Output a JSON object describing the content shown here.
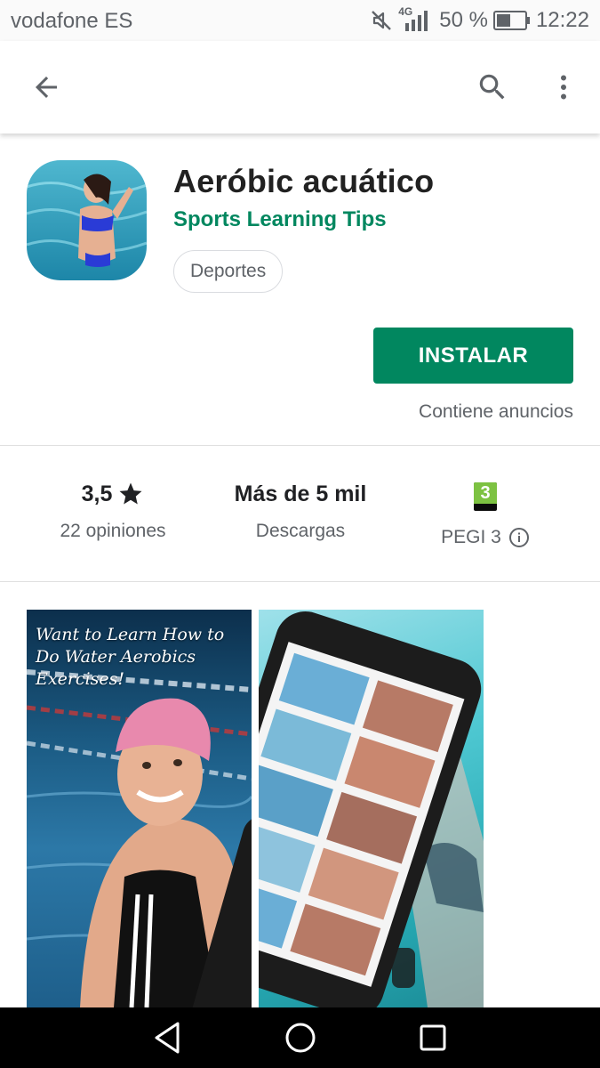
{
  "status_bar": {
    "carrier": "vodafone ES",
    "network": "4G",
    "battery": "50 %",
    "battery_level": 0.5,
    "time": "12:22"
  },
  "toolbar": {
    "back_icon": "arrow-back-icon",
    "search_icon": "search-icon",
    "more_icon": "more-vert-icon"
  },
  "app": {
    "title": "Aeróbic acuático",
    "developer": "Sports Learning Tips",
    "category": "Deportes",
    "install_label": "INSTALAR",
    "ads_note": "Contiene anuncios"
  },
  "stats": {
    "rating": "3,5",
    "rating_label": "22 opiniones",
    "downloads": "Más de 5 mil",
    "downloads_label": "Descargas",
    "pegi_number": "3",
    "pegi_label": "PEGI 3"
  },
  "screenshots": {
    "first_caption": "Want to Learn How to Do Water Aerobics Exercises!"
  },
  "colors": {
    "accent": "#01875f",
    "text_primary": "#212121",
    "text_secondary": "#5f6368",
    "pegi_green": "#7dc242"
  },
  "nav": {
    "back_icon": "nav-back-icon",
    "home_icon": "nav-home-icon",
    "recents_icon": "nav-recents-icon"
  }
}
